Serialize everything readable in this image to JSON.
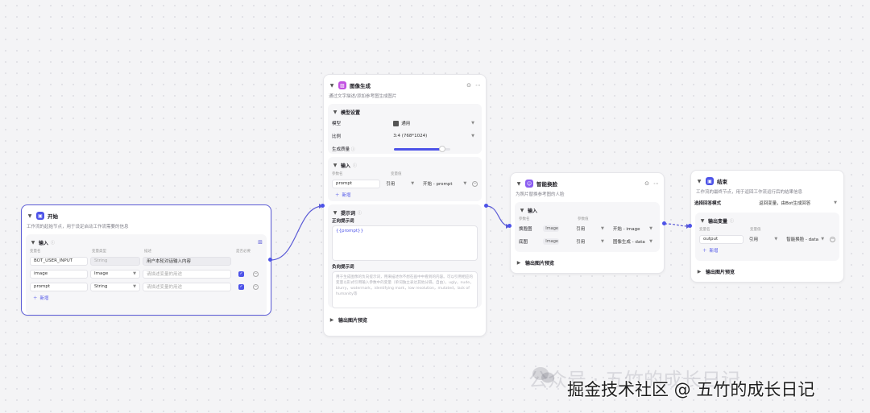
{
  "start_node": {
    "title": "开始",
    "desc": "工作流的起始节点，用于设定启动工作流需要的信息",
    "input_section": "输入",
    "col_headers": [
      "变量名",
      "变量类型",
      "描述",
      "是否必要"
    ],
    "rows": [
      {
        "name": "BOT_USER_INPUT",
        "type": "String",
        "desc": "用户本轮对话输入内容"
      },
      {
        "name": "image",
        "type": "Image",
        "desc": "请描述变量的用途"
      },
      {
        "name": "prompt",
        "type": "String",
        "desc": "请描述变量的用途"
      }
    ],
    "add_label": "新增"
  },
  "image_gen_node": {
    "title": "图像生成",
    "desc": "通过文字描述/添加参考图生成图片",
    "model_section": "模型设置",
    "model_label": "模型",
    "model_value": "通用",
    "ratio_label": "比例",
    "ratio_value": "3:4 (768*1024)",
    "quality_label": "生成质量",
    "quality_level": 0.85,
    "input_section": "输入",
    "col_headers": [
      "参数名",
      "变量值"
    ],
    "input_row": {
      "name": "prompt",
      "source": "引用",
      "value": "开始 - prompt"
    },
    "add_label": "新增",
    "prompt_section": "提示词",
    "positive_label": "正向提示词",
    "positive_value": "{{prompt}}",
    "negative_label": "负向提示词",
    "negative_placeholder": "用于生成图像的负向提示词，用来描述你不想在画中中看到的内容。可以引用相应的变量以形式引用输入参数中的变量（单词独立表达其他分隔，自由），ugly，nude，blurry，watermark，identifying mark，low resolution，mutated，lack of humanity等",
    "output_preview": "输出图片预览"
  },
  "smart_swap_node": {
    "title": "智能换脸",
    "desc": "为照片替换参考图的人脸",
    "input_section": "输入",
    "col_headers": [
      "参数名",
      "参数值"
    ],
    "rows": [
      {
        "name": "换脸图",
        "tag": "Image",
        "source": "引用",
        "value": "开始 - image"
      },
      {
        "name": "底图",
        "tag": "Image",
        "source": "引用",
        "value": "图像生成 - data"
      }
    ],
    "output_preview": "输出图片预览"
  },
  "end_node": {
    "title": "结束",
    "desc": "工作流的最终节点，用于返回工作流运行后的结果信息",
    "mode_label": "选择回答模式",
    "mode_value": "返回变量，由Bot生成回答",
    "output_section": "输出变量",
    "col_headers": [
      "变量名",
      "变量值"
    ],
    "output_row": {
      "name": "output",
      "source": "引用",
      "value": "智能换脸 - data"
    },
    "add_label": "新增",
    "output_preview": "输出图片预览"
  },
  "watermark": {
    "line1": "公众号 · 五竹的成长日记",
    "line2": "掘金技术社区 @ 五竹的成长日记"
  },
  "colors": {
    "accent": "#4d53e8",
    "edge": "#5b5bd6",
    "start_badge": "#4d53e8",
    "image_badge": "#c252e1",
    "swap_badge": "#8a5cf0",
    "end_badge": "#4d53e8"
  }
}
